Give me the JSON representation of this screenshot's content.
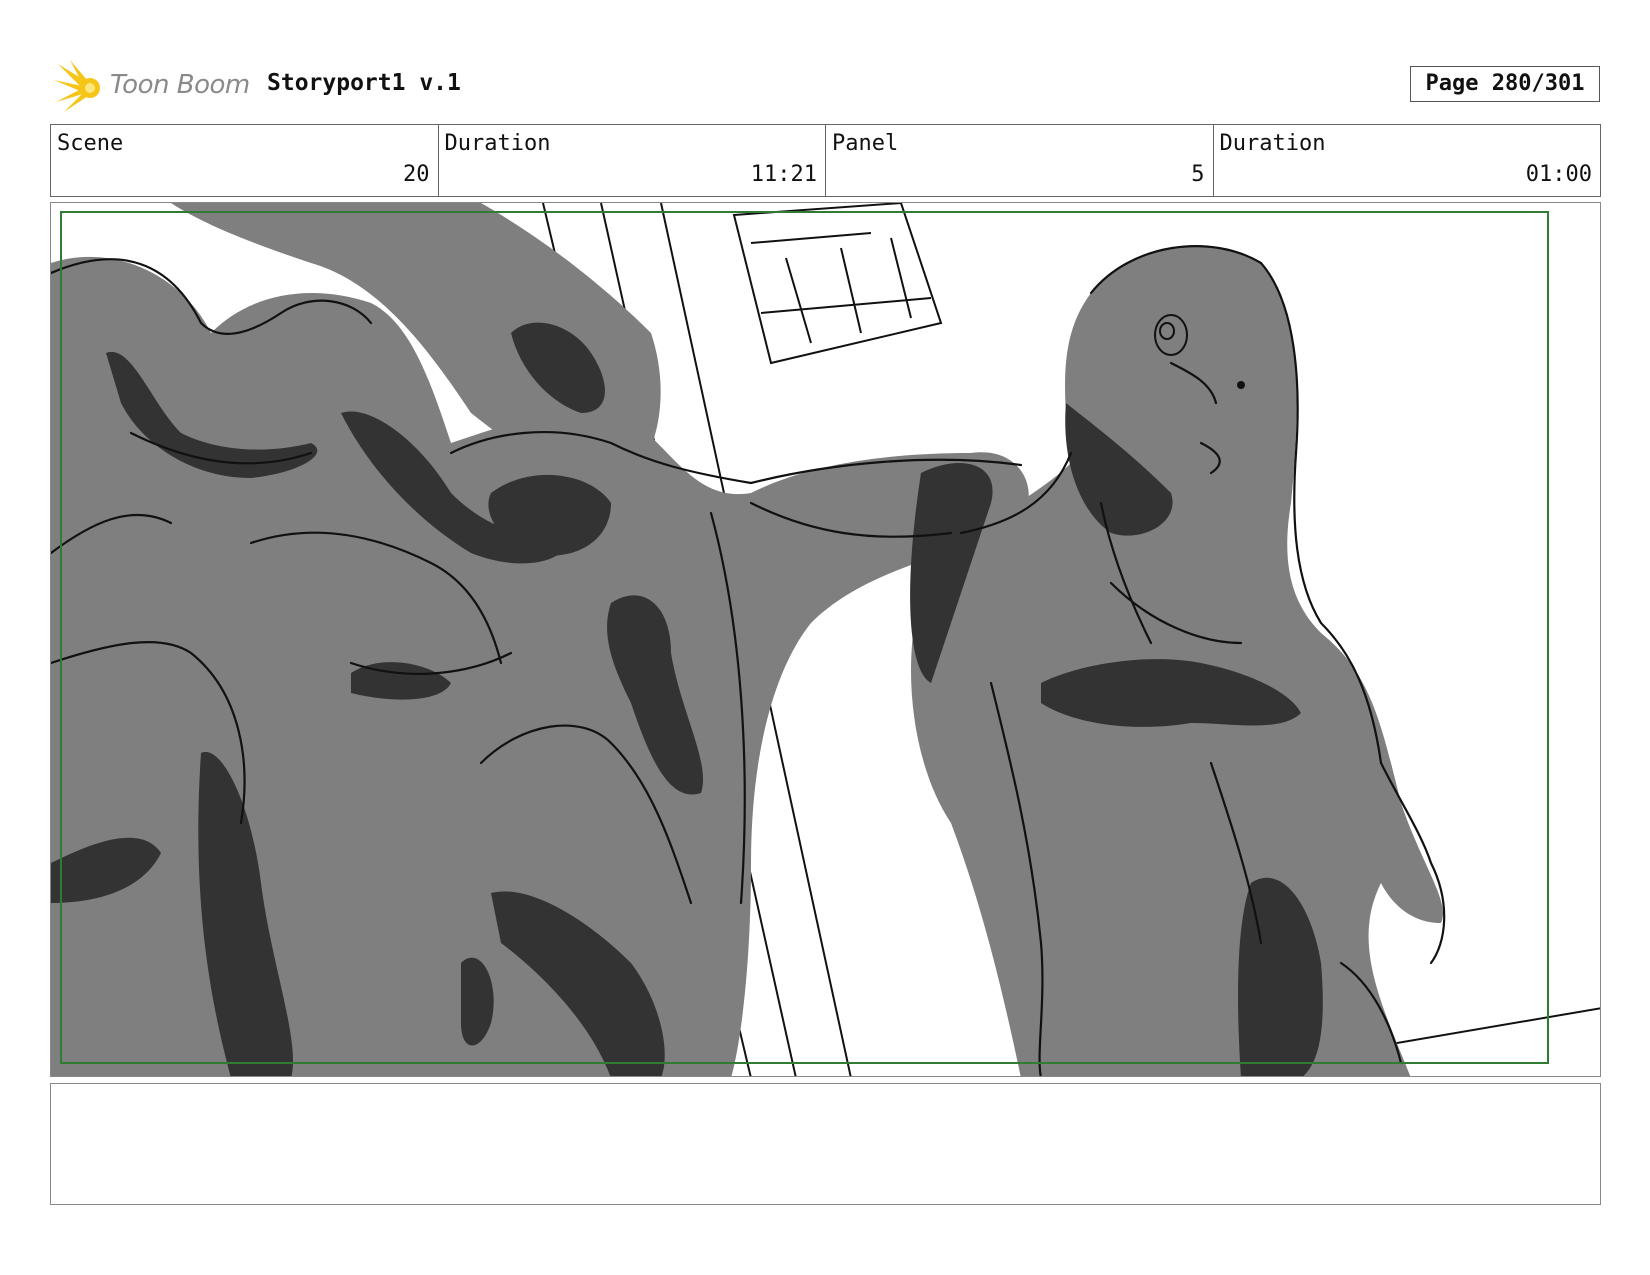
{
  "header": {
    "logo_text": "Toon Boom",
    "project_title": "Storyport1 v.1",
    "page_label": "Page 280/301"
  },
  "info": [
    {
      "label": "Scene",
      "value": "20"
    },
    {
      "label": "Duration",
      "value": "11:21"
    },
    {
      "label": "Panel",
      "value": "5"
    },
    {
      "label": "Duration",
      "value": "01:00"
    }
  ],
  "panel": {
    "description_icon": "sketch-illustration",
    "safe_frame_color": "#2e7d32"
  },
  "notes": {
    "text": ""
  },
  "colors": {
    "logo_yellow": "#f5c518",
    "sketch_mid": "#7f7f7f",
    "sketch_dark": "#333333",
    "ink": "#111111"
  }
}
